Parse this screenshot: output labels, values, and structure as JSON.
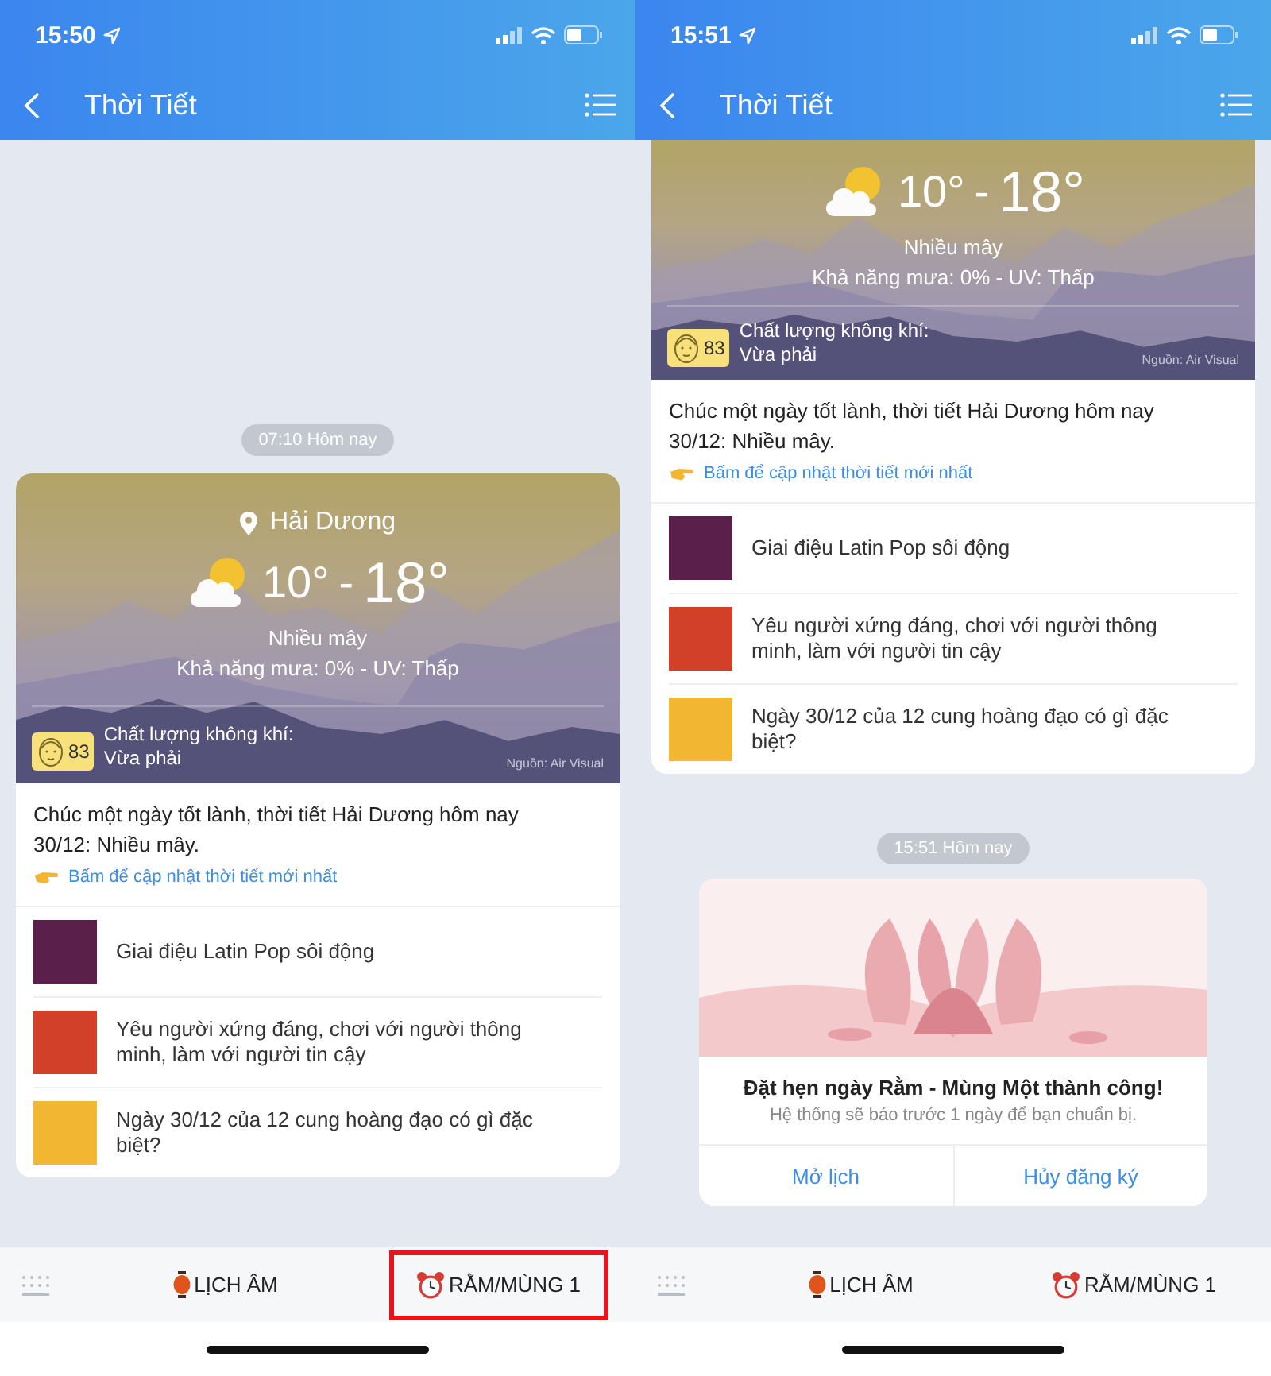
{
  "phones": [
    {
      "status_time": "15:50",
      "nav_title": "Thời Tiết",
      "messages": [
        {
          "kind": "timestamp",
          "text": "07:10 Hôm nay"
        },
        {
          "kind": "weather",
          "location": "Hải Dương",
          "temp_low": "10°",
          "temp_separator": "-",
          "temp_high": "18°",
          "condition": "Nhiều mây",
          "details": "Khả năng mưa: 0% - UV: Thấp",
          "aqi_value": "83",
          "aqi_label": "Chất lượng không khí:",
          "aqi_level": "Vừa phải",
          "source": "Nguồn: Air Visual",
          "greeting": "Chúc một ngày tốt lành, thời tiết Hải Dương hôm nay 30/12: Nhiều mây.",
          "update_link": "Bấm để cập nhật thời tiết mới nhất",
          "articles": [
            {
              "title": "Giai điệu Latin Pop sôi động"
            },
            {
              "title": "Yêu người xứng đáng, chơi với người thông minh, làm với người tin cậy"
            },
            {
              "title": "Ngày 30/12 của 12 cung hoàng đạo có gì đặc biệt?"
            }
          ]
        }
      ],
      "bottom_tabs": [
        {
          "kind": "lantern",
          "label": "LỊCH ÂM",
          "highlighted": false
        },
        {
          "kind": "alarm",
          "label": "RẰM/MÙNG 1",
          "highlighted": true
        }
      ]
    },
    {
      "status_time": "15:51",
      "nav_title": "Thời Tiết",
      "messages": [
        {
          "kind": "weather",
          "temp_low": "10°",
          "temp_separator": "-",
          "temp_high": "18°",
          "condition": "Nhiều mây",
          "details": "Khả năng mưa: 0% - UV: Thấp",
          "aqi_value": "83",
          "aqi_label": "Chất lượng không khí:",
          "aqi_level": "Vừa phải",
          "source": "Nguồn: Air Visual",
          "greeting": "Chúc một ngày tốt lành, thời tiết Hải Dương hôm nay 30/12: Nhiều mây.",
          "update_link": "Bấm để cập nhật thời tiết mới nhất",
          "articles": [
            {
              "title": "Giai điệu Latin Pop sôi động"
            },
            {
              "title": "Yêu người xứng đáng, chơi với người thông minh, làm với người tin cậy"
            },
            {
              "title": "Ngày 30/12 của 12 cung hoàng đạo có gì đặc biệt?"
            }
          ]
        },
        {
          "kind": "timestamp",
          "text": "15:51 Hôm nay"
        },
        {
          "kind": "reminder",
          "title": "Đặt hẹn ngày Rằm - Mùng Một thành công!",
          "subtitle": "Hệ thống sẽ báo trước 1 ngày để bạn chuẩn bị.",
          "buttons": [
            "Mở lịch",
            "Hủy đăng ký"
          ]
        }
      ],
      "bottom_tabs": [
        {
          "kind": "lantern",
          "label": "LỊCH ÂM",
          "highlighted": false
        },
        {
          "kind": "alarm",
          "label": "RẰM/MÙNG 1",
          "highlighted": false
        }
      ]
    }
  ]
}
